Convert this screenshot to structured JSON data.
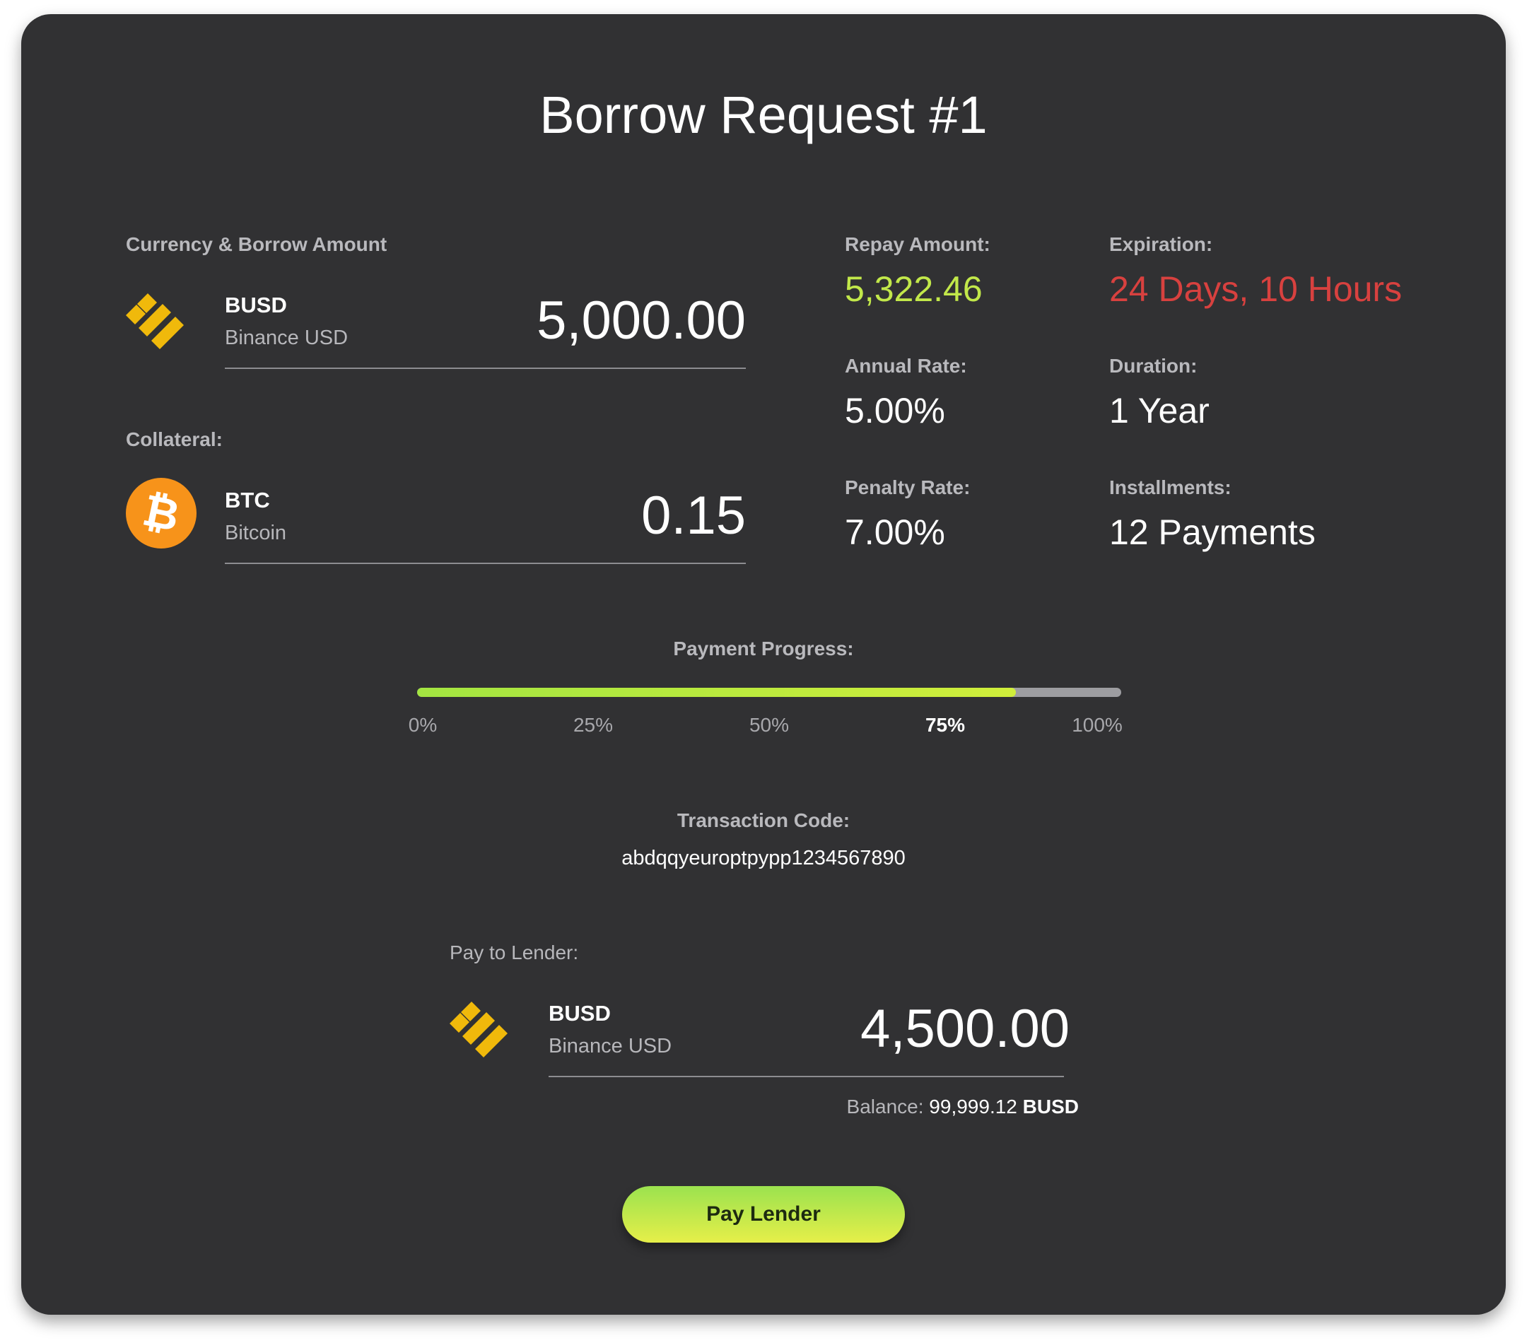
{
  "title": "Borrow Request #1",
  "borrow": {
    "label": "Currency & Borrow Amount",
    "symbol": "BUSD",
    "name": "Binance USD",
    "amount": "5,000.00",
    "icon": "busd-icon"
  },
  "collateral": {
    "label": "Collateral:",
    "symbol": "BTC",
    "name": "Bitcoin",
    "amount": "0.15",
    "icon": "btc-icon"
  },
  "stats": {
    "repay_label": "Repay Amount:",
    "repay_value": "5,322.46",
    "expiration_label": "Expiration:",
    "expiration_value": "24 Days, 10 Hours",
    "annual_label": "Annual Rate:",
    "annual_value": "5.00%",
    "duration_label": "Duration:",
    "duration_value": "1 Year",
    "penalty_label": "Penalty Rate:",
    "penalty_value": "7.00%",
    "installments_label": "Installments:",
    "installments_value": "12 Payments"
  },
  "progress": {
    "label": "Payment Progress:",
    "value_fraction": 0.85,
    "ticks": [
      "0%",
      "25%",
      "50%",
      "75%",
      "100%"
    ],
    "active_tick": "75%"
  },
  "transaction": {
    "label": "Transaction Code:",
    "code": "abdqqyeuroptpypp1234567890"
  },
  "pay": {
    "label": "Pay to Lender:",
    "symbol": "BUSD",
    "name": "Binance USD",
    "amount": "4,500.00",
    "balance_label": "Balance:",
    "balance_value": "99,999.12",
    "balance_currency": "BUSD",
    "button_label": "Pay Lender"
  },
  "colors": {
    "card_bg": "#313133",
    "accent_green": "#c2e84a",
    "expiration_red": "#d8413f",
    "busd_yellow": "#f0b90b",
    "btc_orange": "#f7931a"
  }
}
